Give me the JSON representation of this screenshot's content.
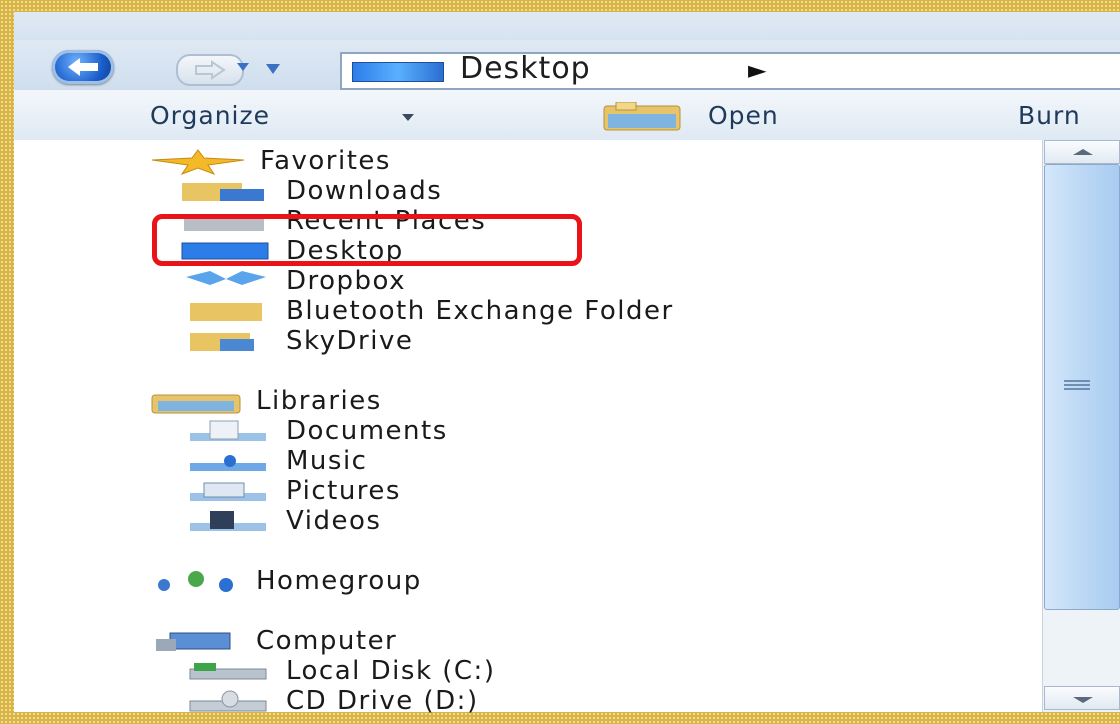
{
  "address": {
    "location": "Desktop",
    "arrow": "►"
  },
  "toolbar": {
    "organize": "Organize",
    "open": "Open",
    "burn": "Burn"
  },
  "nav": {
    "favorites": {
      "label": "Favorites",
      "items": [
        "Downloads",
        "Recent Places",
        "Desktop",
        "Dropbox",
        "Bluetooth Exchange Folder",
        "SkyDrive"
      ]
    },
    "libraries": {
      "label": "Libraries",
      "items": [
        "Documents",
        "Music",
        "Pictures",
        "Videos"
      ]
    },
    "homegroup": {
      "label": "Homegroup"
    },
    "computer": {
      "label": "Computer",
      "items": [
        "Local Disk (C:)",
        "CD Drive (D:)"
      ]
    }
  },
  "highlighted_item": "Desktop",
  "colors": {
    "highlight_border": "#e8141a",
    "frame": "#d8b54a",
    "desktop_icon": "#2d7de8"
  },
  "icons": {
    "back": "back-arrow-icon",
    "forward": "forward-arrow-icon",
    "favorites": "star-icon",
    "libraries": "library-icon",
    "homegroup": "homegroup-icon",
    "computer": "computer-icon"
  }
}
